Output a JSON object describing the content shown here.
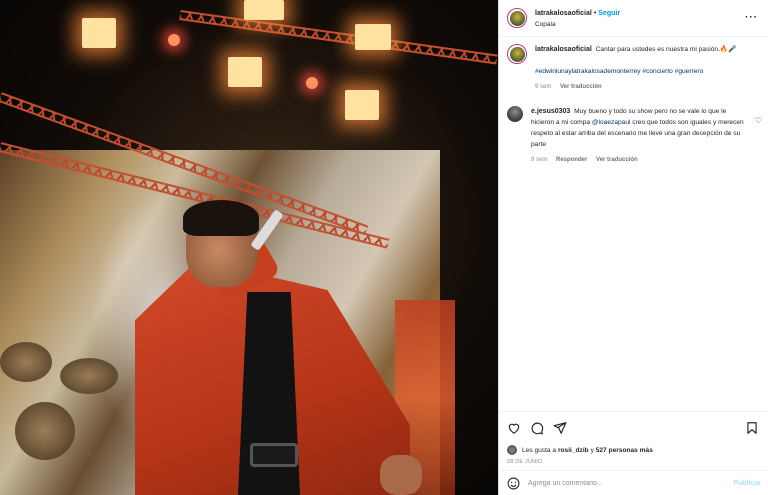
{
  "post": {
    "username": "latrakalosaoficial",
    "follow_label": "Seguir",
    "location": "Copala",
    "more_icon": "more-options-icon"
  },
  "caption": {
    "username": "latrakalosaoficial",
    "text": "Cantar para ustedes es nuestra mi pasión.🔥🎤",
    "hashtags": "#edwinlunaylatrakalosademonterrey #concierto #guerrero",
    "time": "9 sem",
    "translate": "Ver traducción"
  },
  "comment": {
    "username": "e.jesus0303",
    "text_before": "Muy bueno y todo su show pero no se vale lo que le hicieron a mi compa",
    "mention": "@loaezapaul",
    "text_after": "creo que todos son iguales y merecen respeto al estar arriba del escenario me llevé una gran decepción de su parte",
    "time": "9 sem",
    "reply": "Responder",
    "translate": "Ver traducción"
  },
  "likes": {
    "prefix": "Les gusta a",
    "user": "rosii_dzib",
    "connector": "y",
    "others": "527 personas más"
  },
  "date": "28 DE JUNIO",
  "add_comment": {
    "placeholder": "Agrega un comentario...",
    "publish": "Publicar"
  },
  "colors": {
    "link": "#0095f6",
    "hashtag": "#00376b",
    "muted": "#8e8e8e",
    "publish_disabled": "#b2dffc",
    "avatar_ring": "#c13584"
  }
}
